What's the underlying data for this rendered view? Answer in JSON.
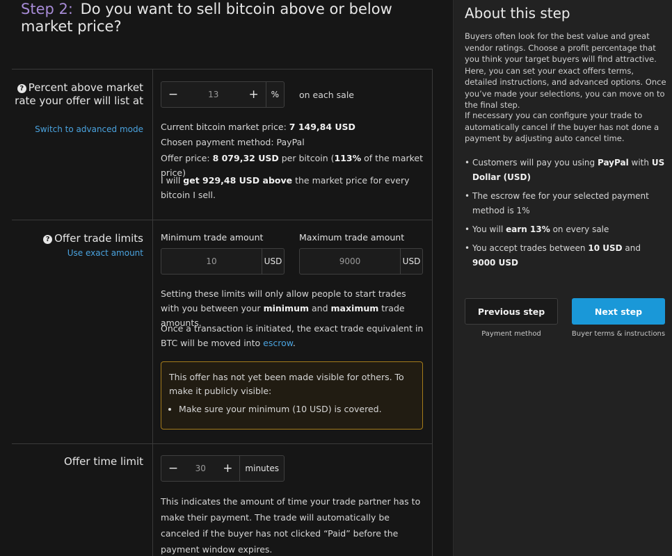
{
  "step": {
    "number": "Step 2:",
    "title": "Do you want to sell bitcoin above or below market price?"
  },
  "percent_section": {
    "label": "Percent above market rate your offer will list at",
    "advanced_link": "Switch to advanced mode",
    "minus": "−",
    "value": "13",
    "plus": "+",
    "unit": "%",
    "suffix": "on each sale",
    "market_price_label": "Current bitcoin market price:",
    "market_price": "7 149,84 USD",
    "payment_method_label": "Chosen payment method:",
    "payment_method": "PayPal",
    "offer_price_label": "Offer price:",
    "offer_price": "8 079,32 USD",
    "offer_price_per": "per bitcoin (",
    "offer_percent": "113%",
    "offer_percent_rest": "of the market price)",
    "summary_pre": "I will",
    "summary_bold": "get 929,48 USD above",
    "summary_post": "the market price for every bitcoin I sell."
  },
  "limits_section": {
    "label": "Offer trade limits",
    "exact_link": "Use exact amount",
    "min_label": "Minimum trade amount",
    "min_value": "10",
    "min_unit": "USD",
    "max_label": "Maximum trade amount",
    "max_value": "9000",
    "max_unit": "USD",
    "note1_pre": "Setting these limits will only allow people to start trades with you between your",
    "note1_min": "minimum",
    "note1_and": "and",
    "note1_max": "maximum",
    "note1_post": "trade amounts.",
    "note2_pre": "Once a transaction is initiated, the exact trade equivalent in BTC will be moved into",
    "note2_link": "escrow",
    "note2_post": ".",
    "warning_text": "This offer has not yet been made visible for others. To make it publicly visible:",
    "warning_item": "Make sure your minimum (10 USD) is covered."
  },
  "time_section": {
    "label": "Offer time limit",
    "minus": "−",
    "value": "30",
    "plus": "+",
    "unit": "minutes",
    "note": "This indicates the amount of time your trade partner has to make their payment. The trade will automatically be canceled if the buyer has not clicked “Paid” before the payment window expires."
  },
  "sidebar": {
    "title": "About this step",
    "para1": "Buyers often look for the best value and great vendor ratings. Choose a profit percentage that you think your target buyers will find attractive. Here, you can set your exact offers terms, detailed instructions, and advanced options. Once you’ve made your selections, you can move on to the final step.",
    "para2": "If necessary you can configure your trade to automatically cancel if the buyer has not done a payment by adjusting auto cancel time.",
    "b1_pre": "Customers will pay you using",
    "b1_bold1": "PayPal",
    "b1_mid": "with",
    "b1_bold2": "US Dollar (USD)",
    "b2": "The escrow fee for your selected payment method is 1%",
    "b3_pre": "You will",
    "b3_bold": "earn 13%",
    "b3_post": "on every sale",
    "b4_pre": "You accept trades between",
    "b4_bold1": "10 USD",
    "b4_mid": "and",
    "b4_bold2": "9000 USD",
    "prev_label": "Previous step",
    "prev_caption": "Payment method",
    "next_label": "Next step",
    "next_caption": "Buyer terms & instructions"
  },
  "colors": {
    "accent": "#1a98d8",
    "step_number": "#a78bd6",
    "warning_border": "#a57c1b"
  }
}
